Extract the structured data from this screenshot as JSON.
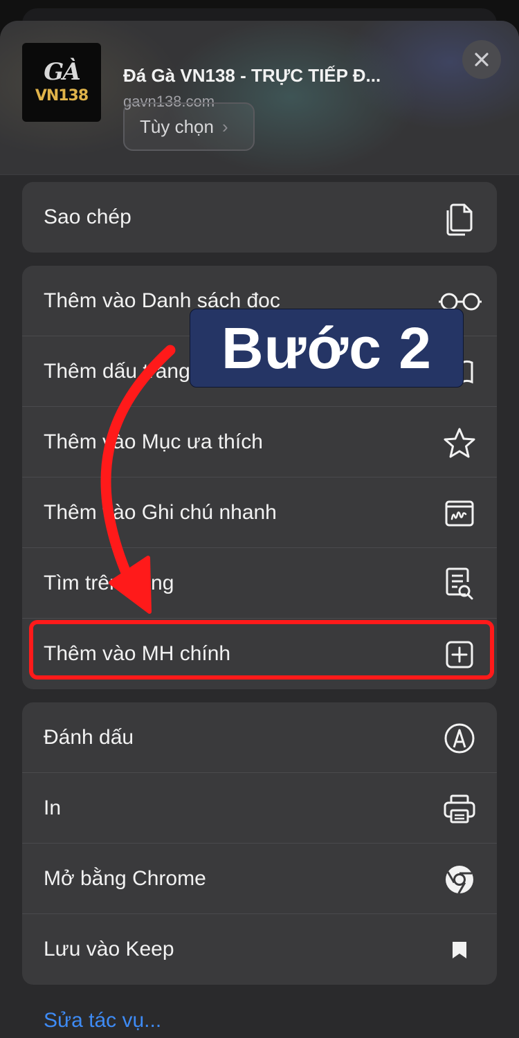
{
  "header": {
    "logo_top": "GÀ",
    "logo_bottom": "VN138",
    "title": "Đá Gà VN138 - TRỰC TIẾP Đ...",
    "url": "gavn138.com",
    "options_label": "Tùy chọn"
  },
  "groups": {
    "g1": [
      {
        "label": "Sao chép",
        "icon": "copy-icon"
      }
    ],
    "g2": [
      {
        "label": "Thêm vào Danh sách đọc",
        "icon": "glasses-icon"
      },
      {
        "label": "Thêm dấu trang",
        "icon": "book-icon"
      },
      {
        "label": "Thêm vào Mục ưa thích",
        "icon": "star-icon"
      },
      {
        "label": "Thêm vào Ghi chú nhanh",
        "icon": "quick-note-icon"
      },
      {
        "label": "Tìm trên trang",
        "icon": "find-on-page-icon"
      },
      {
        "label": "Thêm vào MH chính",
        "icon": "add-square-icon"
      }
    ],
    "g3": [
      {
        "label": "Đánh dấu",
        "icon": "markup-icon"
      },
      {
        "label": "In",
        "icon": "printer-icon"
      },
      {
        "label": "Mở bằng Chrome",
        "icon": "chrome-icon"
      },
      {
        "label": "Lưu vào Keep",
        "icon": "bookmark-icon"
      }
    ]
  },
  "edit_actions_label": "Sửa tác vụ...",
  "annotation": {
    "step_label": "Bước 2",
    "highlight_color": "#ff1a1a",
    "badge_color": "#253565"
  }
}
